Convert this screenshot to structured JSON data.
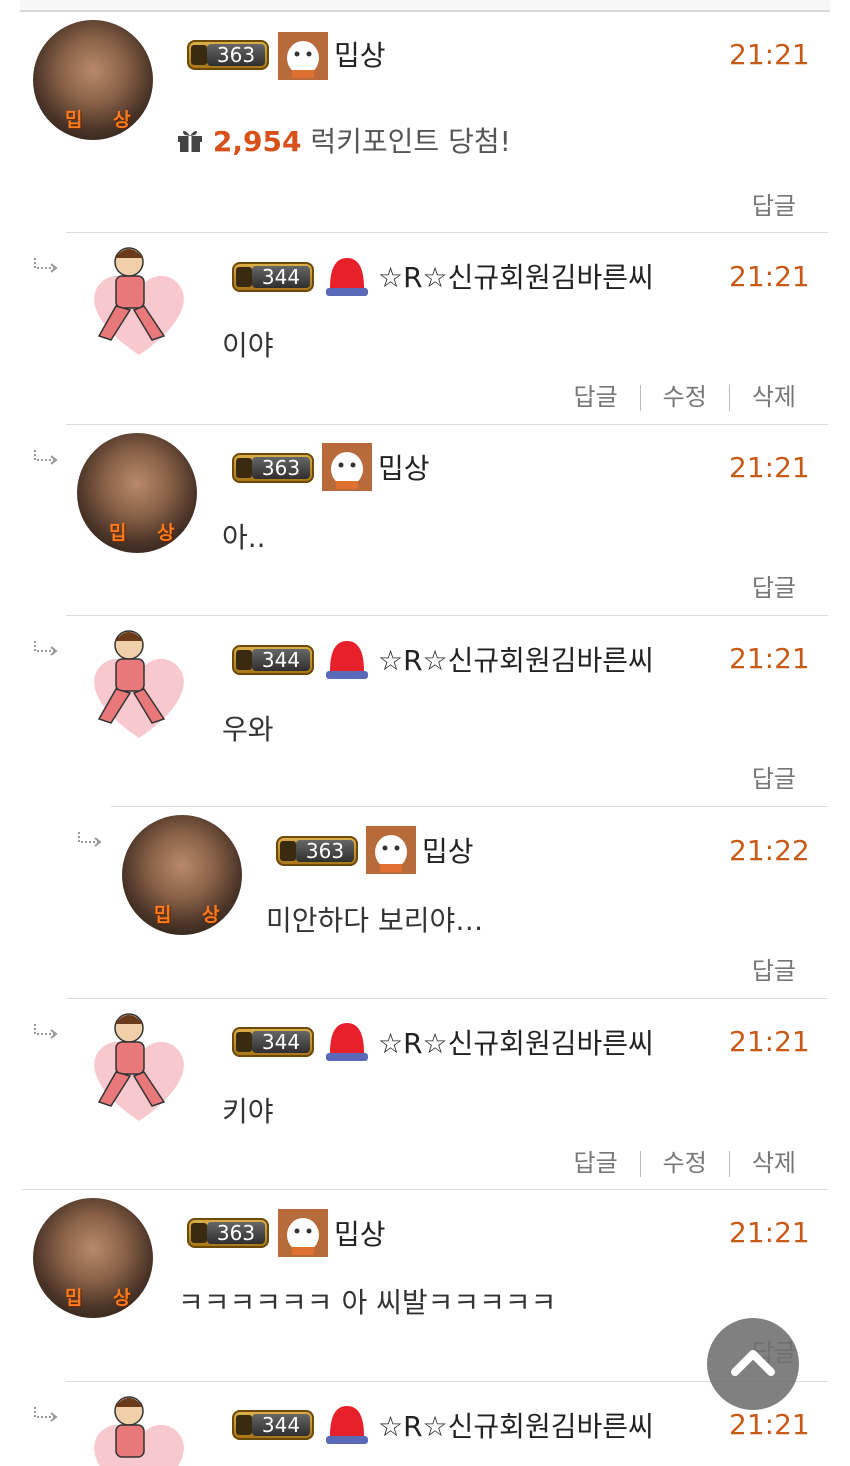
{
  "comments": [
    {
      "level": "363",
      "nick": "밉상",
      "time": "21:21",
      "lucky_points": "2,954",
      "lucky_text": "럭키포인트 당첨!",
      "actions": [
        "답글"
      ]
    },
    {
      "level": "344",
      "nick": "☆R☆신규회원김바른씨",
      "time": "21:21",
      "text": "이야",
      "actions": [
        "답글",
        "수정",
        "삭제"
      ]
    },
    {
      "level": "363",
      "nick": "밉상",
      "time": "21:21",
      "text": "아..",
      "actions": [
        "답글"
      ]
    },
    {
      "level": "344",
      "nick": "☆R☆신규회원김바른씨",
      "time": "21:21",
      "text": "우와",
      "actions": [
        "답글"
      ]
    },
    {
      "level": "363",
      "nick": "밉상",
      "time": "21:22",
      "text": "미안하다 보리야…",
      "actions": [
        "답글"
      ]
    },
    {
      "level": "344",
      "nick": "☆R☆신규회원김바른씨",
      "time": "21:21",
      "text": "키야",
      "actions": [
        "답글",
        "수정",
        "삭제"
      ]
    },
    {
      "level": "363",
      "nick": "밉상",
      "time": "21:21",
      "text": "ㅋㅋㅋㅋㅋㅋ 아 씨발ㅋㅋㅋㅋㅋ",
      "actions": [
        "답글"
      ]
    },
    {
      "level": "344",
      "nick": "☆R☆신규회원김바른씨",
      "time": "21:21"
    }
  ],
  "avatar_tag": "밉 상",
  "icons": {
    "reply_arrow": "reply-arrow-icon",
    "gift": "gift-icon",
    "scroll_top": "chevron-up-icon"
  },
  "colors": {
    "time": "#c85a18",
    "lucky_points": "#d8501a"
  }
}
